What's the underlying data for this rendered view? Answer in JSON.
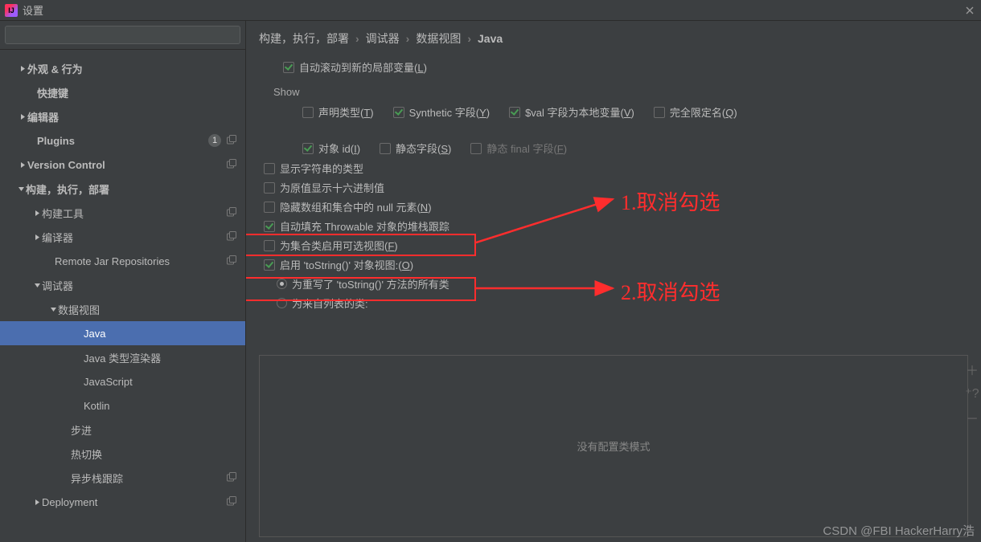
{
  "title": "设置",
  "search_placeholder": "",
  "sidebar": {
    "items": [
      {
        "label": "外观 & 行为",
        "indent": 22,
        "tw": "right",
        "bold": true
      },
      {
        "label": "快捷键",
        "indent": 34,
        "bold": true
      },
      {
        "label": "编辑器",
        "indent": 22,
        "tw": "right",
        "bold": true
      },
      {
        "label": "Plugins",
        "indent": 34,
        "bold": true,
        "badge": "1",
        "trail": "overlap"
      },
      {
        "label": "Version Control",
        "indent": 22,
        "tw": "right",
        "bold": true,
        "trail": "overlap"
      },
      {
        "label": "构建，执行，部署",
        "indent": 20,
        "tw": "down",
        "bold": true
      },
      {
        "label": "构建工具",
        "indent": 40,
        "tw": "right",
        "trail": "overlap"
      },
      {
        "label": "编译器",
        "indent": 40,
        "tw": "right",
        "trail": "overlap"
      },
      {
        "label": "Remote Jar Repositories",
        "indent": 56,
        "trail": "overlap"
      },
      {
        "label": "调试器",
        "indent": 40,
        "tw": "down"
      },
      {
        "label": "数据视图",
        "indent": 60,
        "tw": "down"
      },
      {
        "label": "Java",
        "indent": 92,
        "selected": true
      },
      {
        "label": "Java 类型渲染器",
        "indent": 92
      },
      {
        "label": "JavaScript",
        "indent": 92
      },
      {
        "label": "Kotlin",
        "indent": 92
      },
      {
        "label": "步进",
        "indent": 76
      },
      {
        "label": "热切换",
        "indent": 76
      },
      {
        "label": "异步栈跟踪",
        "indent": 76,
        "trail": "overlap"
      },
      {
        "label": "Deployment",
        "indent": 40,
        "tw": "right",
        "trail": "overlap"
      }
    ]
  },
  "breadcrumb": [
    "构建，执行，部署",
    "调试器",
    "数据视图",
    "Java"
  ],
  "options": {
    "autoscroll": {
      "label": "自动滚动到新的局部变量(",
      "mn": "L",
      "suffix": ")",
      "checked": true
    },
    "show_title": "Show",
    "show": [
      {
        "label": "声明类型(",
        "mn": "T",
        "suffix": ")",
        "checked": false
      },
      {
        "label": "Synthetic 字段(",
        "mn": "Y",
        "suffix": ")",
        "checked": true
      },
      {
        "label": "$val 字段为本地变量(",
        "mn": "V",
        "suffix": ")",
        "checked": true
      },
      {
        "label": "完全限定名(",
        "mn": "Q",
        "suffix": ")",
        "checked": false
      },
      {
        "label": "对象 id(",
        "mn": "I",
        "suffix": ")",
        "checked": true
      },
      {
        "label": "静态字段(",
        "mn": "S",
        "suffix": ")",
        "checked": false
      },
      {
        "label": "静态 final 字段(",
        "mn": "F",
        "suffix": ")",
        "checked": false,
        "dim": true
      }
    ],
    "rows": [
      {
        "label": "显示字符串的类型",
        "checked": false
      },
      {
        "label": "为原值显示十六进制值",
        "checked": false
      },
      {
        "label": "隐藏数组和集合中的 null 元素(",
        "mn": "N",
        "suffix": ")",
        "checked": false
      },
      {
        "label": "自动填充 Throwable 对象的堆栈跟踪",
        "checked": true
      },
      {
        "label": "为集合类启用可选视图(",
        "mn": "F",
        "suffix": ")",
        "checked": false
      },
      {
        "label": "启用 'toString()' 对象视图:(",
        "mn": "O",
        "suffix": ")",
        "checked": true
      }
    ],
    "radios": {
      "r1": "为重写了 'toString()' 方法的所有类",
      "r2": "为来自列表的类:"
    }
  },
  "empty": "没有配置类模式",
  "anno": {
    "a1": "1.取消勾选",
    "a2": "2.取消勾选"
  },
  "watermark": "CSDN @FBI HackerHarry浩"
}
